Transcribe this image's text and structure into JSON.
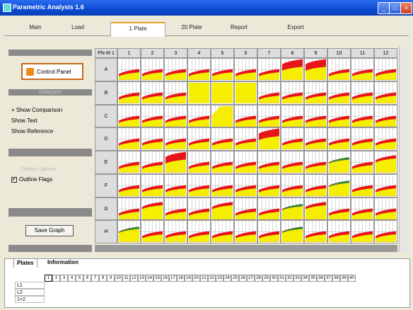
{
  "window": {
    "title": "Parametric Analysis 1.6"
  },
  "tabs": [
    "Main",
    "Load",
    "1 Plate",
    "20 Plate",
    "Report",
    "Export"
  ],
  "left_panel": {
    "control_panel_label": "Control Panel",
    "section1_label": "Datatypes",
    "options": [
      "+ Show Comparison",
      "Show Test",
      "Show Reference"
    ],
    "section2_label": "Display Options",
    "outline_flags_label": "Outline Flags",
    "outline_flags_checked": true,
    "save_graph_label": "Save Graph"
  },
  "grid": {
    "corner_label": "PN-M 1",
    "columns": [
      "1",
      "2",
      "3",
      "4",
      "5",
      "6",
      "7",
      "8",
      "9",
      "10",
      "11",
      "12"
    ],
    "rows": [
      "A",
      "B",
      "C",
      "D",
      "E",
      "F",
      "G",
      "H"
    ],
    "colors": {
      "red": "#e8141c",
      "yellow": "#f5ee00",
      "green": "#2a8a3a",
      "gridline": "#b0b0b0"
    },
    "wells": [
      [
        "n",
        "n",
        "n",
        "n",
        "n",
        "n",
        "n",
        "tall",
        "tall",
        "n",
        "n",
        "n"
      ],
      [
        "n",
        "n",
        "n",
        "fullY",
        "fullY",
        "fullY",
        "n",
        "n",
        "n",
        "n",
        "n",
        "n"
      ],
      [
        "n",
        "n",
        "n",
        "n",
        "stepY",
        "n",
        "n",
        "n",
        "n",
        "n",
        "n",
        "n"
      ],
      [
        "n",
        "n",
        "n",
        "n",
        "n",
        "n",
        "tall",
        "n",
        "n",
        "n",
        "n",
        "n"
      ],
      [
        "n",
        "n",
        "tall",
        "n",
        "n",
        "n",
        "n",
        "n",
        "n",
        "green",
        "n",
        "high"
      ],
      [
        "n",
        "n",
        "n",
        "n",
        "n",
        "n",
        "n",
        "n",
        "n",
        "green",
        "n",
        "n"
      ],
      [
        "n",
        "high",
        "n",
        "n",
        "high",
        "n",
        "n",
        "green",
        "high",
        "n",
        "n",
        "n"
      ],
      [
        "green",
        "n",
        "n",
        "n",
        "n",
        "n",
        "n",
        "green",
        "n",
        "n",
        "n",
        "n"
      ]
    ]
  },
  "bottom": {
    "tabs": [
      "Plates",
      "Information"
    ],
    "plate_numbers": [
      "1",
      "2",
      "3",
      "4",
      "5",
      "6",
      "7",
      "8",
      "9",
      "10",
      "11",
      "12",
      "13",
      "14",
      "15",
      "16",
      "17",
      "18",
      "19",
      "20",
      "21",
      "22",
      "23",
      "24",
      "25",
      "26",
      "27",
      "28",
      "29",
      "30",
      "31",
      "32",
      "33",
      "34",
      "35",
      "36",
      "37",
      "38",
      "39",
      "40"
    ],
    "selected_plate": "1",
    "row_labels": [
      "L1",
      "L2",
      "1+2"
    ]
  }
}
